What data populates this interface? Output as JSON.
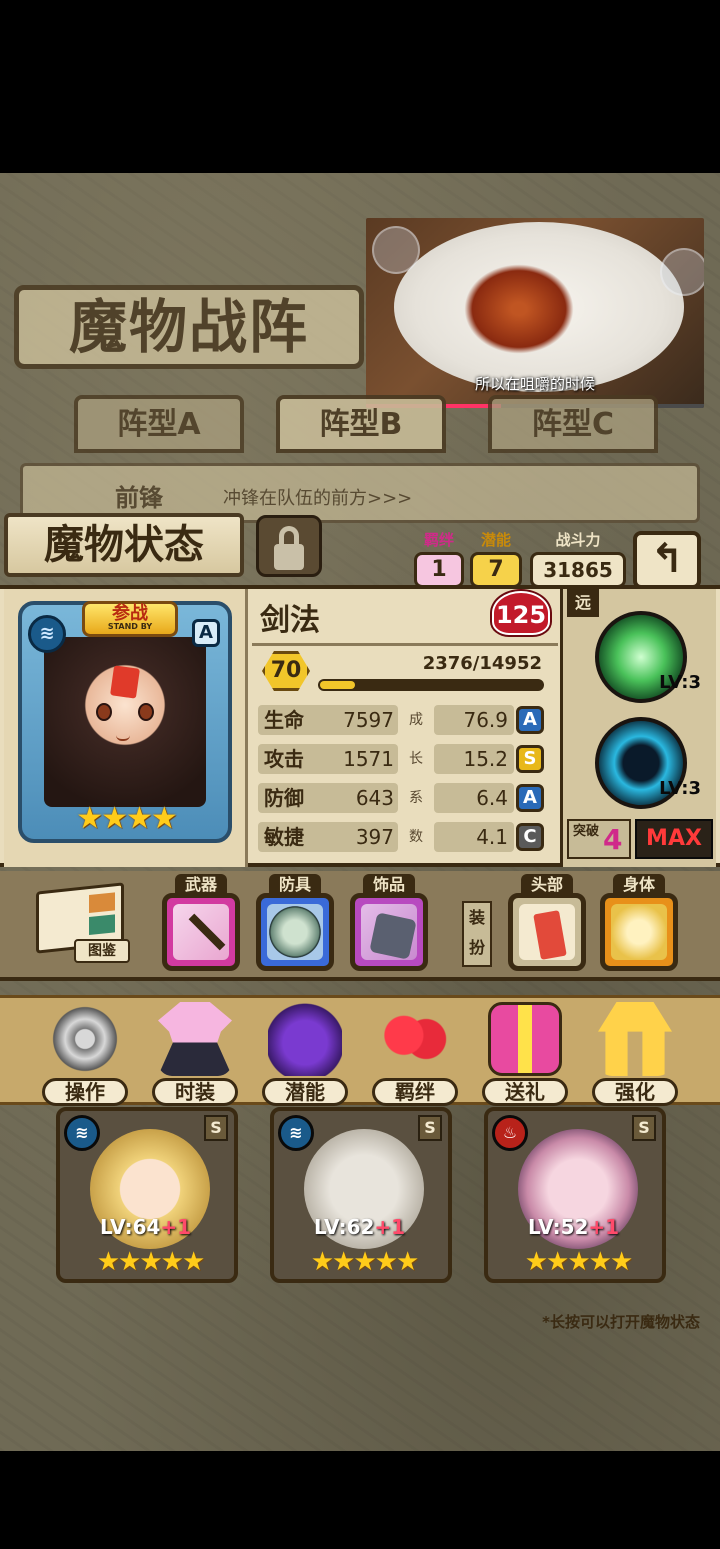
{
  "title": "魔物战阵",
  "video": {
    "watermark": "",
    "subtitle": "所以在咀嚼的时候",
    "progress": 0.4
  },
  "tabs": [
    "阵型A",
    "阵型B",
    "阵型C"
  ],
  "front": {
    "label": "前锋",
    "desc": "冲锋在队伍的前方>>>"
  },
  "status": {
    "title": "魔物状态",
    "bond": {
      "label": "羁绊",
      "value": "1"
    },
    "potential": {
      "label": "潜能",
      "value": "7"
    },
    "power": {
      "label": "战斗力",
      "value": "31865"
    },
    "back_label": "↰"
  },
  "monster": {
    "standby": "参战",
    "standby_en": "STAND BY",
    "rank": "A",
    "element_icon": "water-icon",
    "stars": "★★★★",
    "star_count": 4,
    "skill_name": "剑法",
    "heart_value": "125",
    "level": "70",
    "exp": "2376/14952",
    "exp_fraction": 0.159
  },
  "stats": [
    {
      "name": "生命",
      "value": "7597",
      "sep": "成",
      "growth": "76.9",
      "rank": "A",
      "rank_color": "#2a6ab8"
    },
    {
      "name": "攻击",
      "value": "1571",
      "sep": "长",
      "growth": "15.2",
      "rank": "S",
      "rank_color": "#e8b81a"
    },
    {
      "name": "防御",
      "value": "643",
      "sep": "系",
      "growth": "6.4",
      "rank": "A",
      "rank_color": "#2a6ab8"
    },
    {
      "name": "敏捷",
      "value": "397",
      "sep": "数",
      "growth": "4.1",
      "rank": "C",
      "rank_color": "#5a5a5a"
    }
  ],
  "skills": {
    "range": "远",
    "skill1_lv": "LV:3",
    "skill2_lv": "LV:3",
    "break_label": "突破",
    "break_value": "4",
    "max_label": "MAX"
  },
  "equipment": {
    "book_label": "图鉴",
    "weapon_label": "武器",
    "armor_label": "防具",
    "accessory_label": "饰品",
    "dress_label": "装扮",
    "head_label": "头部",
    "body_label": "身体"
  },
  "actions": [
    "操作",
    "时装",
    "潜能",
    "羁绊",
    "送礼",
    "强化"
  ],
  "team": [
    {
      "lv": "LV:64",
      "plus": "+1",
      "rank": "S",
      "element": "water"
    },
    {
      "lv": "LV:62",
      "plus": "+1",
      "rank": "S",
      "element": "water"
    },
    {
      "lv": "LV:52",
      "plus": "+1",
      "rank": "S",
      "element": "fire"
    }
  ],
  "team_stars": "★★★★★",
  "hint": "*长按可以打开魔物状态"
}
